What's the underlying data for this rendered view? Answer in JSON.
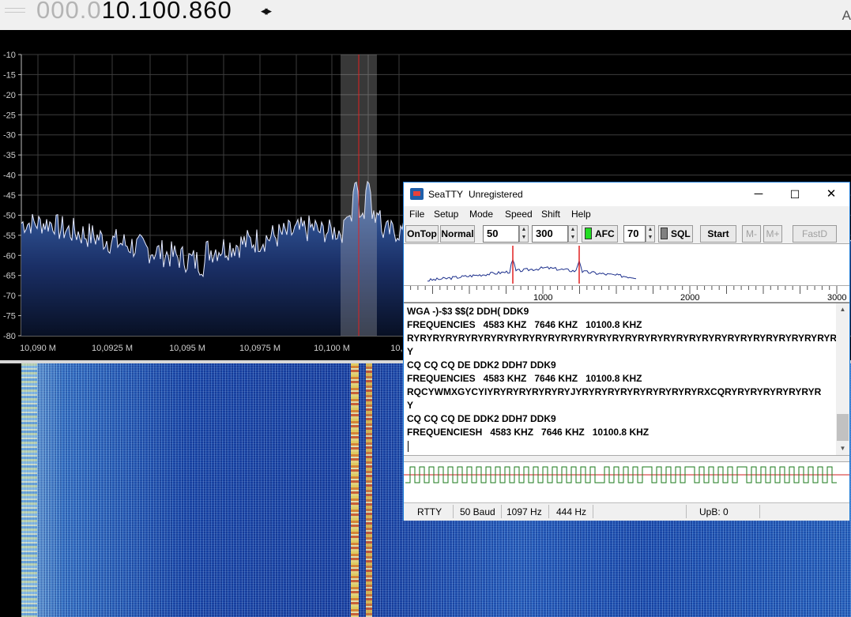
{
  "sdr": {
    "freq_dim": "000.0",
    "freq_bright": "10.100.860",
    "freq_arrows": "◂▸",
    "corner_glyph": "A",
    "spectrum": {
      "y_ticks": [
        "-10",
        "-15",
        "-20",
        "-25",
        "-30",
        "-35",
        "-40",
        "-45",
        "-50",
        "-55",
        "-60",
        "-65",
        "-70",
        "-75",
        "-80"
      ],
      "x_ticks": [
        "10,090 M",
        "10,0925 M",
        "10,095 M",
        "10,0975 M",
        "10,100 M",
        "10,1"
      ]
    }
  },
  "seatty": {
    "title": "SeaTTY",
    "subtitle": "Unregistered",
    "window_controls": {
      "minimize": "─",
      "maximize": "☐",
      "close": "✕"
    },
    "menu": [
      "File",
      "Setup",
      "Mode",
      "Speed",
      "Shift",
      "Help"
    ],
    "toolbar": {
      "ontop": "OnTop",
      "normal": "Normal",
      "speed_value": "50",
      "shift_value": "300",
      "afc_label": "AFC",
      "squelch_value": "70",
      "sql_label": "SQL",
      "start": "Start",
      "m_minus": "M-",
      "m_plus": "M+",
      "fastd": "FastD"
    },
    "scale_labels": [
      "1000",
      "2000",
      "3000"
    ],
    "text_lines": [
      "WGA -)-$3 $$(2 DDH( DDK9",
      "FREQUENCIES   4583 KHZ   7646 KHZ   10100.8 KHZ",
      "RYRYRYRYRYRYRYRYRYRYRYRYRYRYRYRYRYRYRYRYRYRYRYRYRYRYRYRYRYRYRYRYRYR",
      "Y",
      "CQ CQ CQ DE DDK2 DDH7 DDK9",
      "FREQUENCIES   4583 KHZ   7646 KHZ   10100.8 KHZ",
      "RQCYWMXGYCYIYRYRYRYRYRYRYJYRYRYRYRYRYRYRYRYRYRXCQRYRYRYRYRYRYRYR",
      "Y",
      "CQ CQ CQ DE DDK2 DDH7 DDK9",
      "FREQUENCIESH   4583 KHZ   7646 KHZ   10100.8 KHZ"
    ],
    "status": {
      "mode": "RTTY",
      "baud": "50 Baud",
      "center": "1097 Hz",
      "shift": "444 Hz",
      "upb": "UpB: 0"
    },
    "colors": {
      "afc_led": "#22dd22",
      "sql_led": "#808080",
      "title_border": "#1a7ad6"
    }
  }
}
